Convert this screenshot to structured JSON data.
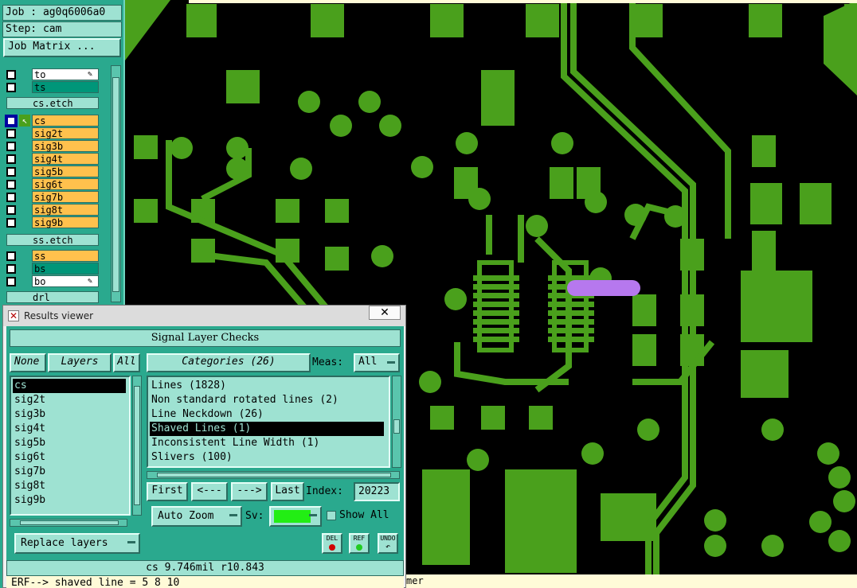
{
  "job_label": "Job : ag0q6006a0",
  "step_label": "Step: cam",
  "job_matrix_button": "Job Matrix ...",
  "layers": [
    {
      "name": "to",
      "color": "#ffffff",
      "icon": "true"
    },
    {
      "name": "ts",
      "color": "#009679",
      "icon": ""
    },
    {
      "name": "cs.etch",
      "color": "#9ee2d2",
      "icon": ""
    },
    {
      "name": "cs",
      "color": "#ffc14d",
      "icon": ""
    },
    {
      "name": "sig2t",
      "color": "#ffc14d",
      "icon": ""
    },
    {
      "name": "sig3b",
      "color": "#ffc14d",
      "icon": ""
    },
    {
      "name": "sig4t",
      "color": "#ffc14d",
      "icon": ""
    },
    {
      "name": "sig5b",
      "color": "#ffc14d",
      "icon": ""
    },
    {
      "name": "sig6t",
      "color": "#ffc14d",
      "icon": ""
    },
    {
      "name": "sig7b",
      "color": "#ffc14d",
      "icon": ""
    },
    {
      "name": "sig8t",
      "color": "#ffc14d",
      "icon": ""
    },
    {
      "name": "sig9b",
      "color": "#ffc14d",
      "icon": ""
    },
    {
      "name": "ss.etch",
      "color": "#9ee2d2",
      "icon": ""
    },
    {
      "name": "ss",
      "color": "#ffc14d",
      "icon": ""
    },
    {
      "name": "bs",
      "color": "#009679",
      "icon": ""
    },
    {
      "name": "bo",
      "color": "#ffffff",
      "icon": "true"
    },
    {
      "name": "drl",
      "color": "#9ee2d2",
      "icon": ""
    }
  ],
  "results_viewer": {
    "window_title": "Results viewer",
    "close_glyph": "✕",
    "header": "Signal Layer Checks",
    "none_button": "None",
    "layers_button": "Layers",
    "all_button": "All",
    "categories_button": "Categories (26)",
    "meas_label": "Meas:",
    "meas_value": "All",
    "layer_items": [
      "cs",
      "sig2t",
      "sig3b",
      "sig4t",
      "sig5b",
      "sig6t",
      "sig7b",
      "sig8t",
      "sig9b"
    ],
    "selected_layer": "cs",
    "category_items": [
      "Lines (1828)",
      "Non standard rotated lines (2)",
      "Line Neckdown (26)",
      "Shaved Lines (1)",
      "Inconsistent Line Width (1)",
      "Slivers (100)"
    ],
    "selected_category": "Shaved Lines (1)",
    "first_button": "First",
    "prev_button": "<---",
    "next_button": "--->",
    "last_button": "Last",
    "index_label": "Index:",
    "index_value": "20223",
    "auto_zoom": "Auto Zoom",
    "sv_label": "Sv:",
    "show_all_label": "Show All",
    "replace_layers": "Replace layers",
    "del_label": "DEL",
    "ref_label": "REF",
    "undo_label": "UNDO",
    "status_text": "cs 9.746mil  r10.843",
    "command_text": "ERF--> shaved line = 5 8 10"
  },
  "bottom_text": "mer",
  "colors": {
    "copper": "#4aa01c",
    "highlight": "#b678ee",
    "panel_bg": "#2aa98e",
    "panel_light": "#9ee2d2",
    "sv_swatch": "#22ee14"
  }
}
